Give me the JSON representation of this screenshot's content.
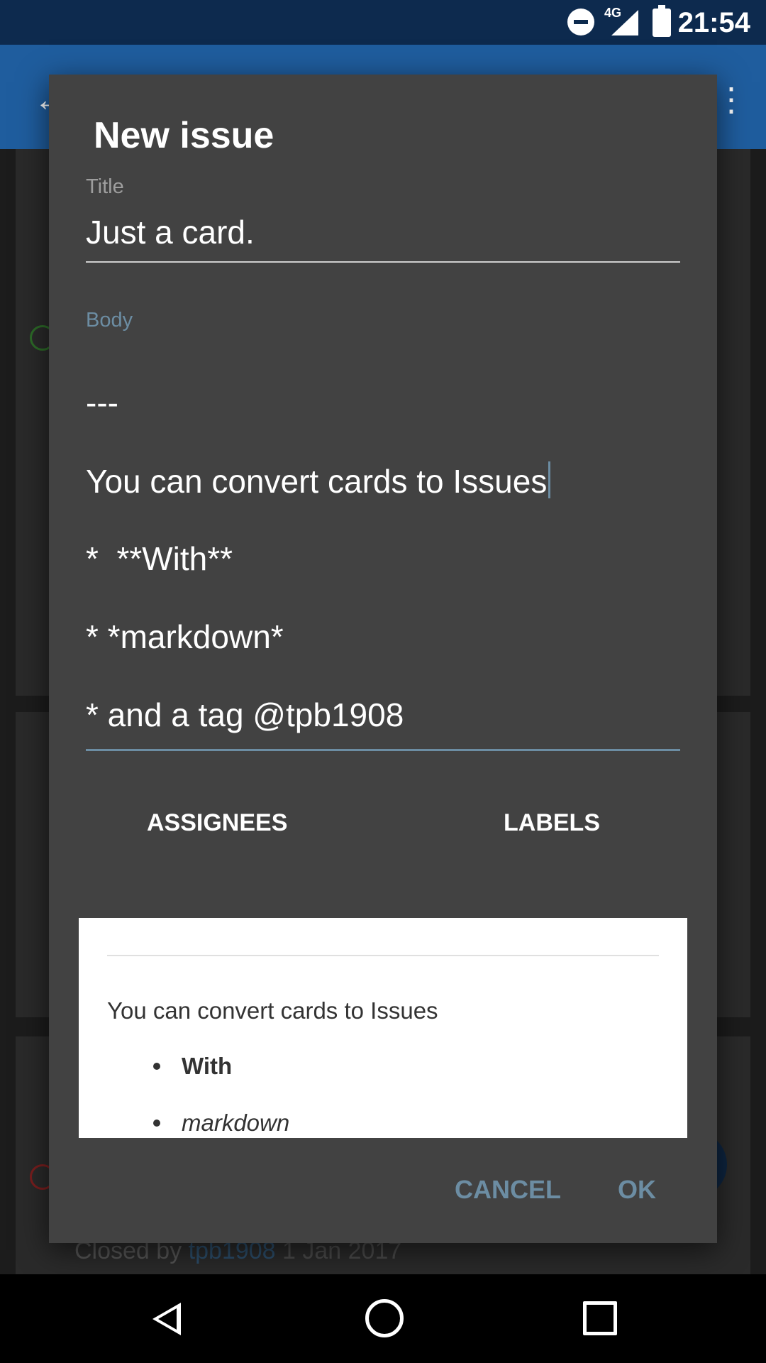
{
  "status_bar": {
    "time": "21:54",
    "network": "4G",
    "icons": [
      "do-not-disturb-icon",
      "signal-icon",
      "battery-icon"
    ]
  },
  "app_bar": {
    "icons": [
      "back-arrow-icon",
      "overflow-menu-icon"
    ]
  },
  "background": {
    "closed_by_prefix": "Closed by",
    "closed_by_user": "tpb1908",
    "closed_date": "1 Jan 2017"
  },
  "dialog": {
    "title": "New issue",
    "title_field": {
      "label": "Title",
      "value": "Just a card."
    },
    "body_field": {
      "label": "Body",
      "lines": [
        "---",
        "You can convert cards to Issues",
        "*  **With**",
        "* *markdown*",
        "* and a tag @tpb1908"
      ]
    },
    "assignees_label": "ASSIGNEES",
    "labels_label": "LABELS",
    "preview": {
      "paragraph": "You can convert cards to Issues",
      "items": [
        {
          "text": "With",
          "style": "bold"
        },
        {
          "text": "markdown",
          "style": "italic"
        }
      ]
    },
    "cancel_label": "CANCEL",
    "ok_label": "OK"
  },
  "nav_bar": {
    "icons": [
      "nav-back-icon",
      "nav-home-icon",
      "nav-recents-icon"
    ]
  },
  "colors": {
    "status_bar": "#0d2a4e",
    "app_bar": "#1f5d9e",
    "dialog_bg": "#424242",
    "accent": "#6c8da3"
  }
}
